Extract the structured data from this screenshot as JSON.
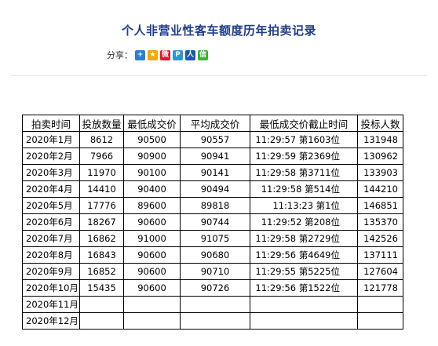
{
  "title": "个人非营业性客车额度历年拍卖记录",
  "share": {
    "label": "分享：",
    "icons": [
      {
        "name": "share-more-icon",
        "glyph": "+",
        "color": "#2d7fd3"
      },
      {
        "name": "qzone-icon",
        "glyph": "★",
        "color": "#f3a712"
      },
      {
        "name": "weibo-icon",
        "glyph": "微",
        "color": "#e6162d"
      },
      {
        "name": "tencent-weibo-icon",
        "glyph": "P",
        "color": "#2a98d8"
      },
      {
        "name": "renren-icon",
        "glyph": "人",
        "color": "#1d58b3"
      },
      {
        "name": "wechat-icon",
        "glyph": "信",
        "color": "#3eb135"
      }
    ]
  },
  "table": {
    "headers": [
      "拍卖时间",
      "投放数量",
      "最低成交价",
      "平均成交价",
      "最低成交价截止时间",
      "投标人数"
    ],
    "rows": [
      [
        "2020年1月",
        "8612",
        "90500",
        "90557",
        "11:29:57 第1603位",
        "131948"
      ],
      [
        "2020年2月",
        "7966",
        "90900",
        "90941",
        "11:29:59 第2369位",
        "130962"
      ],
      [
        "2020年3月",
        "11970",
        "90100",
        "90141",
        "11:29:58 第3711位",
        "133903"
      ],
      [
        "2020年4月",
        "14410",
        "90400",
        "90494",
        "11:29:58 第514位",
        "144210"
      ],
      [
        "2020年5月",
        "17776",
        "89600",
        "89818",
        "11:13:23 第1位",
        "146851"
      ],
      [
        "2020年6月",
        "18267",
        "90600",
        "90744",
        "11:29:52 第208位",
        "135370"
      ],
      [
        "2020年7月",
        "16862",
        "91000",
        "91075",
        "11:29:58 第2729位",
        "142526"
      ],
      [
        "2020年8月",
        "16843",
        "90600",
        "90680",
        "11:29:56 第4649位",
        "137111"
      ],
      [
        "2020年9月",
        "16852",
        "90600",
        "90710",
        "11:29:55 第5225位",
        "127604"
      ],
      [
        "2020年10月",
        "15435",
        "90600",
        "90726",
        "11:29:56 第1522位",
        "121778"
      ],
      [
        "2020年11月",
        "",
        "",
        "",
        "",
        ""
      ],
      [
        "2020年12月",
        "",
        "",
        "",
        "",
        ""
      ]
    ]
  }
}
